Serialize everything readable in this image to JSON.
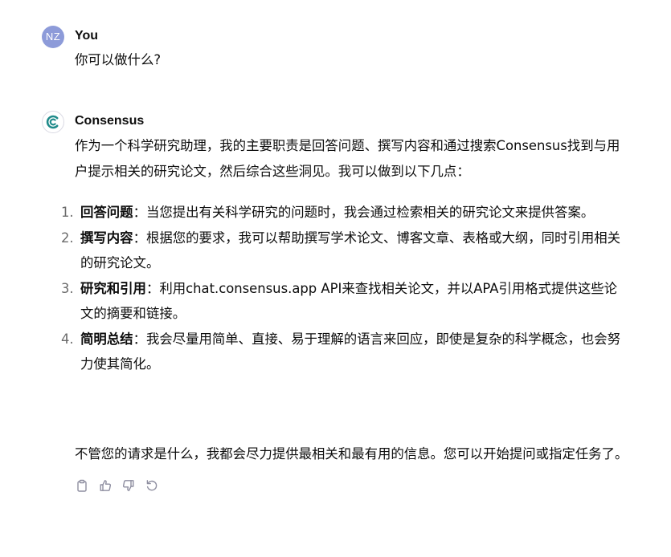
{
  "colors": {
    "user_avatar_bg": "#8d9bd9",
    "bot_logo": "#1f8a8a",
    "text": "#0d0d0d",
    "icon": "#8e8ea0"
  },
  "user_message": {
    "avatar_initials": "NZ",
    "author": "You",
    "text": "你可以做什么?"
  },
  "bot_message": {
    "avatar_icon": "consensus-logo-icon",
    "author": "Consensus",
    "intro": "作为一个科学研究助理，我的主要职责是回答问题、撰写内容和通过搜索Consensus找到与用户提示相关的研究论文，然后综合这些洞见。我可以做到以下几点：",
    "points": [
      {
        "number": "1.",
        "title": "回答问题",
        "text": "：当您提出有关科学研究的问题时，我会通过检索相关的研究论文来提供答案。"
      },
      {
        "number": "2.",
        "title": "撰写内容",
        "text": "：根据您的要求，我可以帮助撰写学术论文、博客文章、表格或大纲，同时引用相关的研究论文。"
      },
      {
        "number": "3.",
        "title": "研究和引用",
        "text": "：利用chat.consensus.app API来查找相关论文，并以APA引用格式提供这些论文的摘要和链接。"
      },
      {
        "number": "4.",
        "title": "简明总结",
        "text": "：我会尽量用简单、直接、易于理解的语言来回应，即使是复杂的科学概念，也会努力使其简化。"
      }
    ],
    "closing": "不管您的请求是什么，我都会尽力提供最相关和最有用的信息。您可以开始提问或指定任务了。"
  },
  "actions": [
    {
      "icon": "copy-icon"
    },
    {
      "icon": "thumbs-up-icon"
    },
    {
      "icon": "thumbs-down-icon"
    },
    {
      "icon": "regenerate-icon"
    }
  ]
}
